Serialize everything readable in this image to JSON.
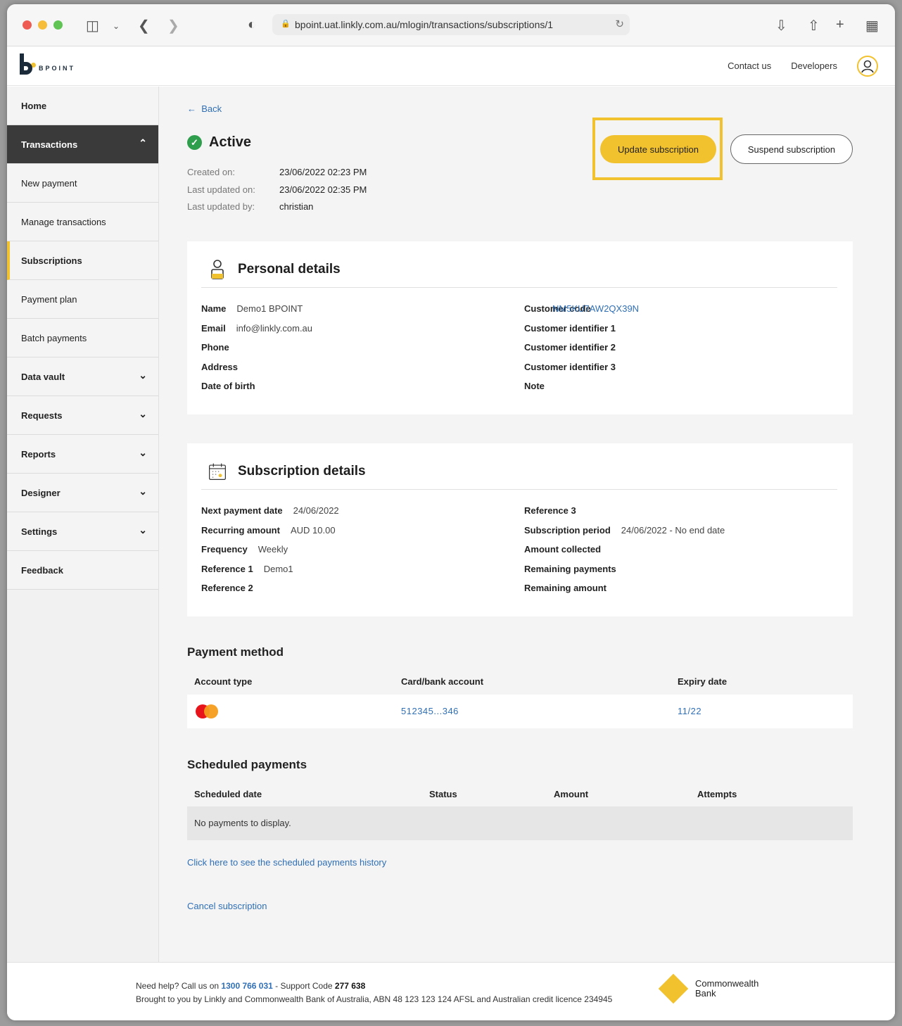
{
  "browser": {
    "url": "bpoint.uat.linkly.com.au/mlogin/transactions/subscriptions/1"
  },
  "header": {
    "logo_text": "BPOINT",
    "contact_label": "Contact us",
    "developers_label": "Developers"
  },
  "sidebar": {
    "items": [
      {
        "label": "Home"
      },
      {
        "label": "Transactions"
      },
      {
        "label": "New payment"
      },
      {
        "label": "Manage transactions"
      },
      {
        "label": "Subscriptions"
      },
      {
        "label": "Payment plan"
      },
      {
        "label": "Batch payments"
      },
      {
        "label": "Data vault"
      },
      {
        "label": "Requests"
      },
      {
        "label": "Reports"
      },
      {
        "label": "Designer"
      },
      {
        "label": "Settings"
      },
      {
        "label": "Feedback"
      }
    ]
  },
  "page": {
    "back_label": "Back",
    "status": "Active",
    "meta": [
      {
        "label": "Created on:",
        "value": "23/06/2022 02:23 PM"
      },
      {
        "label": "Last updated on:",
        "value": "23/06/2022 02:35 PM"
      },
      {
        "label": "Last updated by:",
        "value": "christian"
      }
    ],
    "update_label": "Update subscription",
    "suspend_label": "Suspend subscription"
  },
  "personal": {
    "title": "Personal details",
    "left": [
      {
        "label": "Name",
        "value": "Demo1 BPOINT"
      },
      {
        "label": "Email",
        "value": "info@linkly.com.au"
      },
      {
        "label": "Phone",
        "value": ""
      },
      {
        "label": "Address",
        "value": ""
      },
      {
        "label": "Date of birth",
        "value": ""
      }
    ],
    "right": [
      {
        "label": "Customer code",
        "value": "NM5KU7AW2QX39N"
      },
      {
        "label": "Customer identifier 1",
        "value": ""
      },
      {
        "label": "Customer identifier 2",
        "value": ""
      },
      {
        "label": "Customer identifier 3",
        "value": ""
      },
      {
        "label": "Note",
        "value": ""
      }
    ]
  },
  "subscription": {
    "title": "Subscription details",
    "left": [
      {
        "label": "Next payment date",
        "value": "24/06/2022"
      },
      {
        "label": "Recurring amount",
        "value": "AUD 10.00"
      },
      {
        "label": "Frequency",
        "value": "Weekly"
      },
      {
        "label": "Reference 1",
        "value": "Demo1"
      },
      {
        "label": "Reference 2",
        "value": ""
      }
    ],
    "right": [
      {
        "label": "Reference 3",
        "value": ""
      },
      {
        "label": "Subscription period",
        "value": "24/06/2022 - No end date"
      },
      {
        "label": "Amount collected",
        "value": ""
      },
      {
        "label": "Remaining payments",
        "value": ""
      },
      {
        "label": "Remaining amount",
        "value": ""
      }
    ]
  },
  "payment_method": {
    "title": "Payment method",
    "columns": [
      "Account type",
      "Card/bank account",
      "Expiry date"
    ],
    "row": {
      "card": "512345...346",
      "expiry": "11/22"
    }
  },
  "scheduled": {
    "title": "Scheduled payments",
    "columns": [
      "Scheduled date",
      "Status",
      "Amount",
      "Attempts"
    ],
    "empty": "No payments to display.",
    "history_link": "Click here to see the scheduled payments history",
    "cancel_link": "Cancel subscription"
  },
  "footer": {
    "help_prefix": "Need help? Call us on",
    "phone": "1300 766 031",
    "support_prefix": "- Support Code",
    "support_code": "277 638",
    "line2": "Brought to you by Linkly and Commonwealth Bank of Australia, ABN 48 123 123 124 AFSL and Australian credit licence 234945",
    "bank_line1": "Commonwealth",
    "bank_line2": "Bank"
  },
  "colors": {
    "accent": "#f2c12e",
    "link": "#2f6fb6",
    "nav_active": "#3a3a3a",
    "success": "#2e9e4c"
  }
}
